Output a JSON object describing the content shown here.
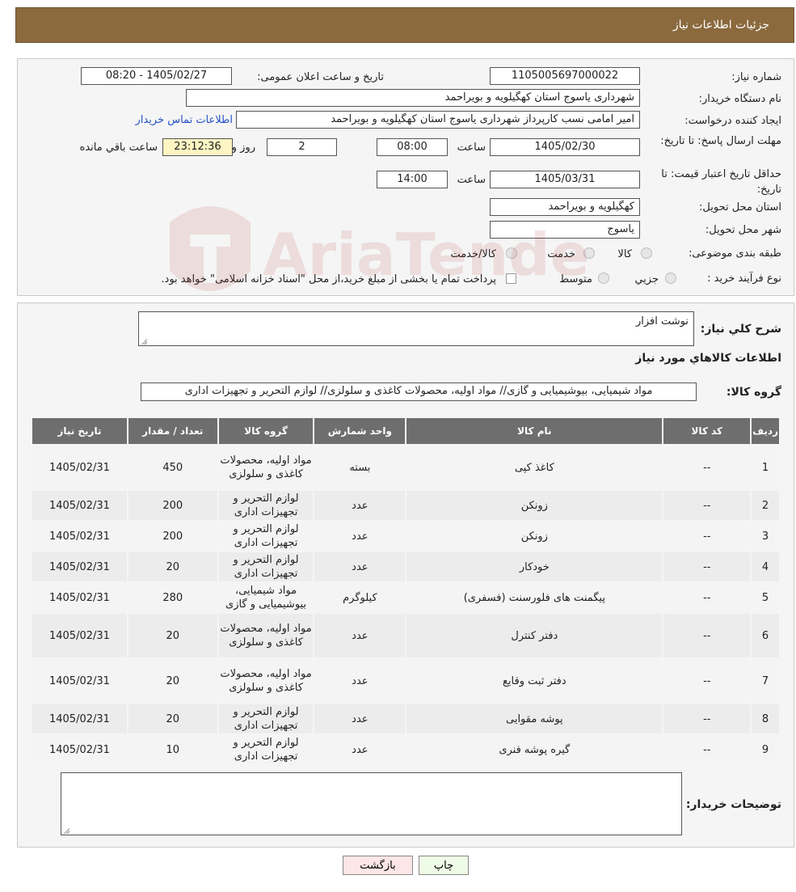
{
  "header": {
    "title": "جزئیات اطلاعات نیاز"
  },
  "form": {
    "need_number_label": "شماره نیاز:",
    "need_number": "1105005697000022",
    "announce_label": "تاریخ و ساعت اعلان عمومی:",
    "announce_value": "1405/02/27 - 08:20",
    "buyer_org_label": "نام دستگاه خریدار:",
    "buyer_org": "شهرداری یاسوج استان کهگیلویه و بویراحمد",
    "requester_label": "ایجاد کننده درخواست:",
    "requester": "امیر امامی نسب کارپرداز شهرداری یاسوج استان کهگیلویه و بویراحمد",
    "contact_link": "اطلاعات تماس خریدار",
    "reply_deadline_label": "مهلت ارسال پاسخ: تا تاریخ:",
    "reply_date": "1405/02/30",
    "time_label": "ساعت",
    "reply_time": "08:00",
    "days_value": "2",
    "days_label": "روز و",
    "remaining_time": "23:12:36",
    "remaining_label": "ساعت باقي مانده",
    "price_validity_label": "حداقل تاریخ اعتبار قیمت: تا تاریخ:",
    "price_date": "1405/03/31",
    "price_time": "14:00",
    "province_label": "استان محل تحویل:",
    "province": "کهگیلویه و بویراحمد",
    "city_label": "شهر محل تحویل:",
    "city": "یاسوج",
    "category_label": "طبقه بندی موضوعی:",
    "category_options": [
      "کالا",
      "خدمت",
      "کالا/خدمت"
    ],
    "process_label": "نوع فرآیند خرید :",
    "process_options": [
      "جزیي",
      "متوسط"
    ],
    "payment_note": "پرداخت تمام یا بخشی از مبلغ خرید،از محل \"اسناد خزانه اسلامی\" خواهد بود."
  },
  "summary": {
    "description_label": "شرح كلي نياز:",
    "description": "نوشت افزار",
    "goods_info_title": "اطلاعات کالاهاي مورد نياز",
    "goods_group_label": "گروه کالا:",
    "goods_group": "مواد شیمیایی، بیوشیمیایی و  گازی// مواد اولیه، محصولات کاغذی و سلولزی// لوازم التحرير و تجهيزات اداری"
  },
  "table": {
    "headers": [
      "ردیف",
      "کد کالا",
      "نام کالا",
      "واحد شمارش",
      "گروه کالا",
      "تعداد / مقدار",
      "تاریخ نیاز"
    ],
    "rows": [
      [
        "1",
        "--",
        "کاغذ کپی",
        "بسته",
        "مواد اولیه، محصولات کاغذی و سلولزی",
        "450",
        "1405/02/31"
      ],
      [
        "2",
        "--",
        "زونکن",
        "عدد",
        "لوازم التحرير و تجهيزات اداری",
        "200",
        "1405/02/31"
      ],
      [
        "3",
        "--",
        "زونکن",
        "عدد",
        "لوازم التحرير و تجهيزات اداری",
        "200",
        "1405/02/31"
      ],
      [
        "4",
        "--",
        "خودکار",
        "عدد",
        "لوازم التحرير و تجهيزات اداری",
        "20",
        "1405/02/31"
      ],
      [
        "5",
        "--",
        "پیگمنت های فلورسنت (فسفری)",
        "کیلوگرم",
        "مواد شیمیایی، بیوشیمیایی و گازی",
        "280",
        "1405/02/31"
      ],
      [
        "6",
        "--",
        "دفتر کنترل",
        "عدد",
        "مواد اولیه، محصولات کاغذی و سلولزی",
        "20",
        "1405/02/31"
      ],
      [
        "7",
        "--",
        "دفتر ثبت وقایع",
        "عدد",
        "مواد اولیه، محصولات کاغذی و سلولزی",
        "20",
        "1405/02/31"
      ],
      [
        "8",
        "--",
        "پوشه مقوایی",
        "عدد",
        "لوازم التحرير و تجهيزات اداری",
        "20",
        "1405/02/31"
      ],
      [
        "9",
        "--",
        "گیره پوشه فنری",
        "عدد",
        "لوازم التحرير و تجهيزات اداری",
        "10",
        "1405/02/31"
      ]
    ]
  },
  "buyer_notes": {
    "label": "توضیحات خریدار:",
    "value": ""
  },
  "buttons": {
    "print": "چاپ",
    "back": "بازگشت"
  },
  "watermark": {
    "text": "AriaTender.neT",
    "color": "#b23a3a"
  }
}
